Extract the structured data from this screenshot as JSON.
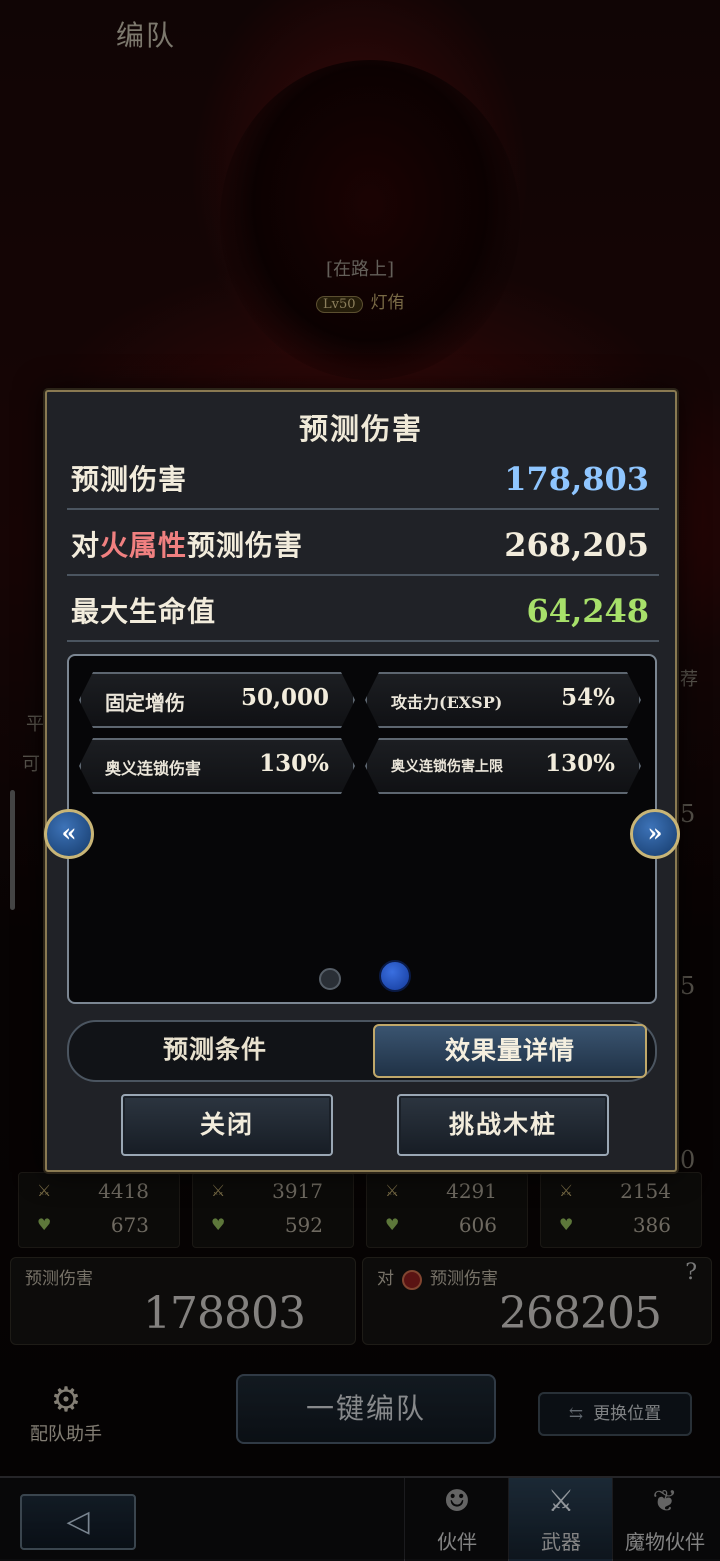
{
  "header": {
    "title": "编队"
  },
  "character": {
    "title": "[在路上]",
    "level": "Lv50",
    "name": "灯侑"
  },
  "side_fragments": {
    "left_a": "平",
    "left_b": "可",
    "right_a": "荐",
    "right_b": "5",
    "right_c": "5",
    "right_d": "0"
  },
  "team_stats": [
    {
      "atk": "4418",
      "hp": "673"
    },
    {
      "atk": "3917",
      "hp": "592"
    },
    {
      "atk": "4291",
      "hp": "606"
    },
    {
      "atk": "2154",
      "hp": "386"
    }
  ],
  "damage_boxes": {
    "predict_label": "预测伤害",
    "predict_value": "178803",
    "vs_prefix": "对",
    "vs_label": "预测伤害",
    "vs_value": "268205",
    "help": "?"
  },
  "footer": {
    "assist": "配队助手",
    "auto_form": "一键编队",
    "swap": "更换位置",
    "tabs": [
      {
        "label": "伙伴",
        "icon": "person-icon"
      },
      {
        "label": "武器",
        "icon": "crossed-swords-icon"
      },
      {
        "label": "魔物伙伴",
        "icon": "dragon-icon"
      }
    ]
  },
  "modal": {
    "title": "预测伤害",
    "rows": [
      {
        "label": "预测伤害",
        "value": "178,803",
        "color": "#8fc6ff"
      },
      {
        "label_pre": "对",
        "label_fire": "火属性",
        "label_post": "预测伤害",
        "value": "268,205",
        "color": "#f2ecdc"
      },
      {
        "label": "最大生命值",
        "value": "64,248",
        "color": "#a7e06a"
      }
    ],
    "chips": [
      {
        "label": "固定增伤",
        "value": "50,000"
      },
      {
        "label": "攻击力(EXSP)",
        "value": "54%"
      },
      {
        "label": "奥义连锁伤害",
        "value": "130%"
      },
      {
        "label": "奥义连锁伤害上限",
        "value": "130%"
      }
    ],
    "tabs": {
      "conditions": "预测条件",
      "details": "效果量详情"
    },
    "buttons": {
      "close": "关闭",
      "challenge": "挑战木桩"
    },
    "arrows": {
      "prev": "«",
      "next": "»"
    }
  }
}
